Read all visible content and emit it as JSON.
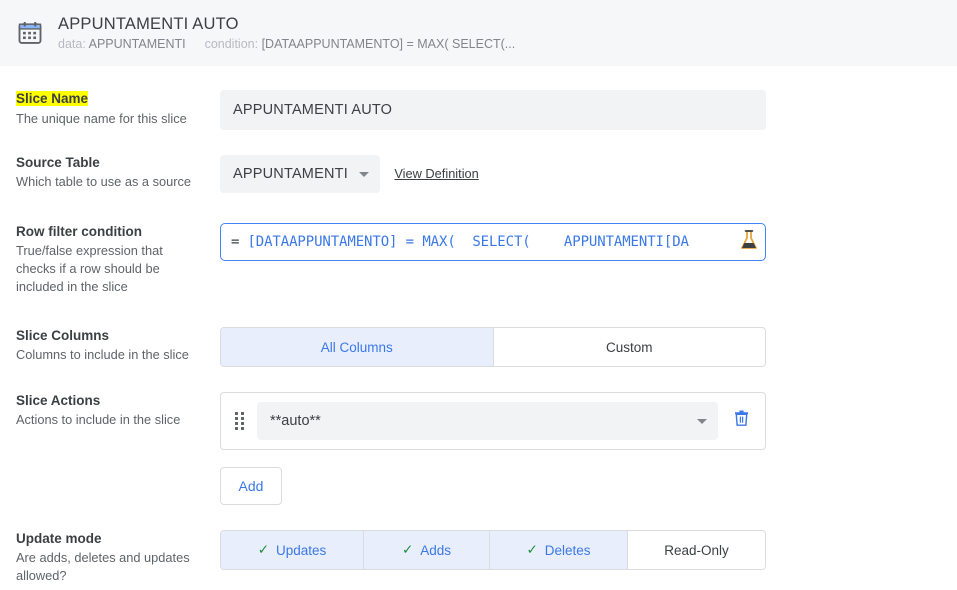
{
  "header": {
    "icon": "calendar-icon",
    "title": "APPUNTAMENTI AUTO",
    "data_label": "data:",
    "data_value": "APPUNTAMENTI",
    "condition_label": "condition:",
    "condition_value": "[DATAAPPUNTAMENTO] = MAX( SELECT(...",
    "background": "#f6f7f9"
  },
  "rows": {
    "slice_name": {
      "label": "Slice Name",
      "description": "The unique name for this slice",
      "highlight": true,
      "highlight_color": "#ffff00",
      "value": "APPUNTAMENTI AUTO"
    },
    "source_table": {
      "label": "Source Table",
      "description": "Which table to use as a source",
      "value": "APPUNTAMENTI",
      "link": "View Definition"
    },
    "row_filter": {
      "label": "Row filter condition",
      "description": "True/false expression that checks if a row should be included in the slice",
      "prefix": "=",
      "expression": "[DATAAPPUNTAMENTO] = MAX(  SELECT(    APPUNTAMENTI[DA",
      "icon": "flask-icon",
      "border_color": "#4285f4",
      "text_color": "#3b78e7"
    },
    "slice_columns": {
      "label": "Slice Columns",
      "description": "Columns to include in the slice",
      "options": [
        {
          "label": "All Columns",
          "selected": true
        },
        {
          "label": "Custom",
          "selected": false
        }
      ]
    },
    "slice_actions": {
      "label": "Slice Actions",
      "description": "Actions to include in the slice",
      "items": [
        {
          "name": "**auto**",
          "drag_icon": "drag-handle-icon",
          "delete_icon": "trash-icon"
        }
      ],
      "add_label": "Add"
    },
    "update_mode": {
      "label": "Update mode",
      "description": "Are adds, deletes and updates allowed?",
      "options": [
        {
          "label": "Updates",
          "selected": true,
          "check": "✓"
        },
        {
          "label": "Adds",
          "selected": true,
          "check": "✓"
        },
        {
          "label": "Deletes",
          "selected": true,
          "check": "✓"
        },
        {
          "label": "Read-Only",
          "selected": false,
          "check": ""
        }
      ]
    }
  },
  "colors": {
    "accent": "#3b78e7",
    "check_green": "#1e8e3e",
    "selected_bg": "#e8eefc",
    "field_bg": "#f1f3f4",
    "border": "#dadce0"
  }
}
